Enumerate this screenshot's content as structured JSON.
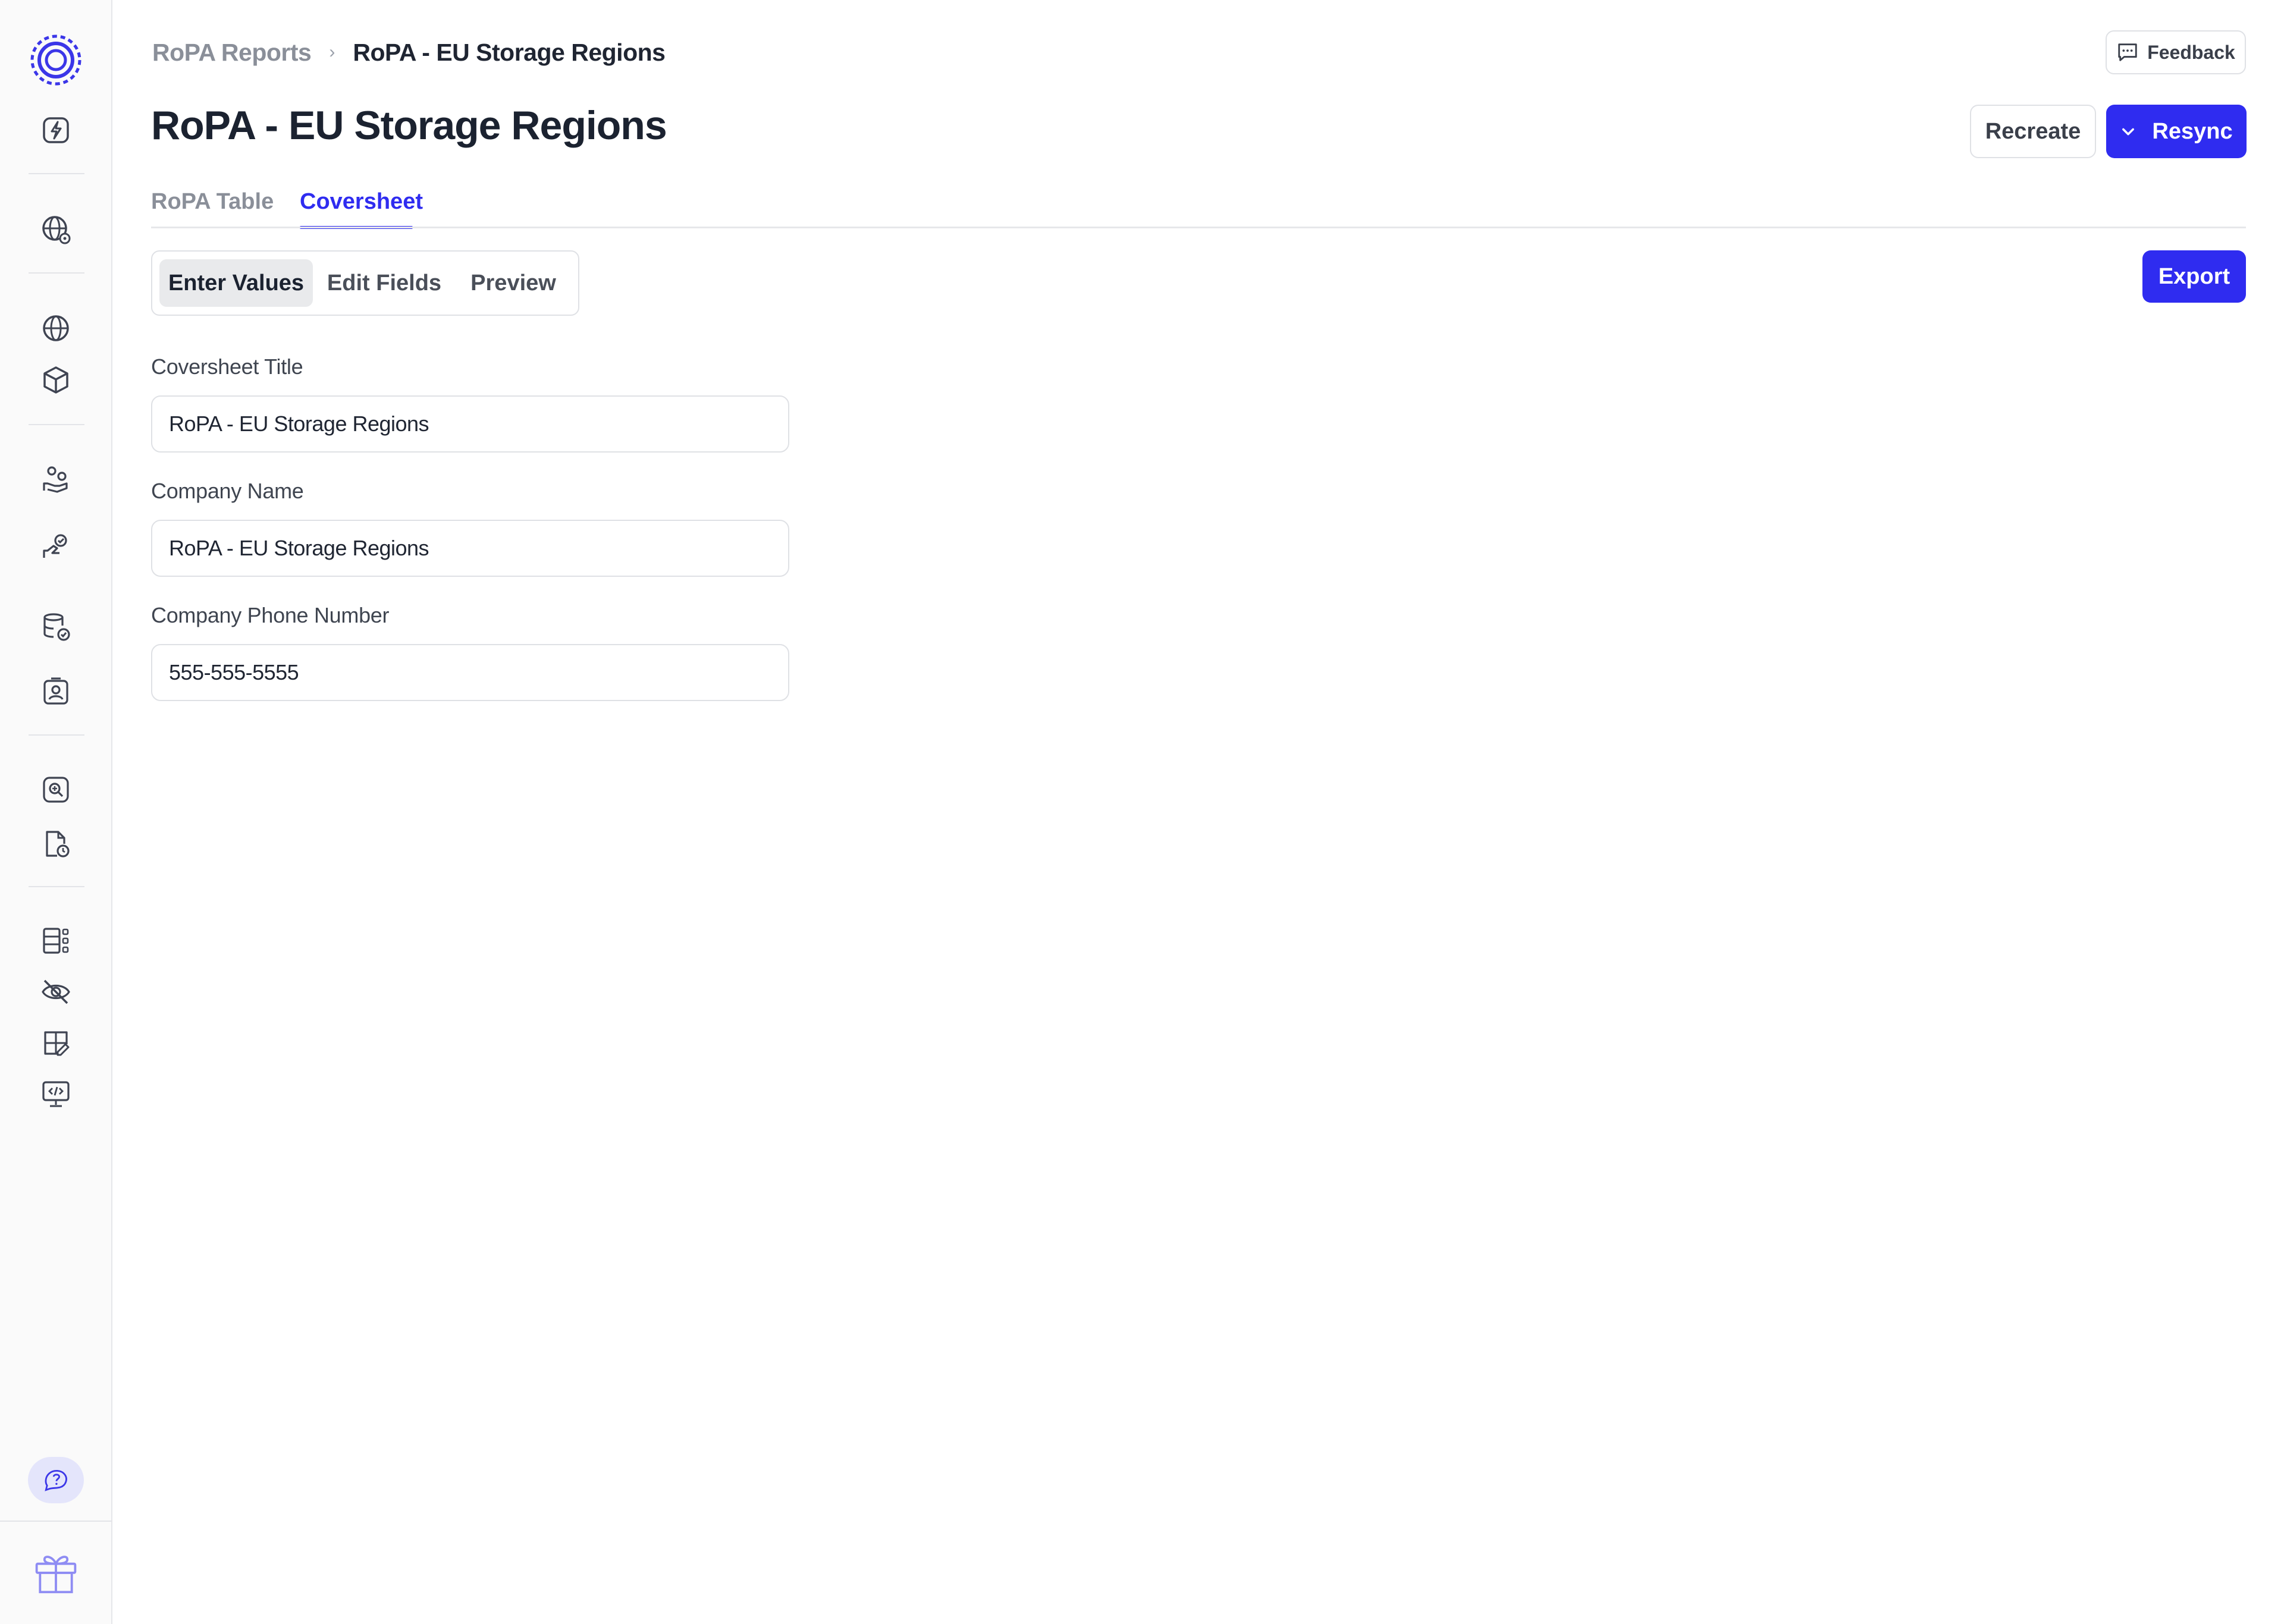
{
  "breadcrumb": {
    "parent": "RoPA Reports",
    "separator": "›",
    "current": "RoPA - EU Storage Regions"
  },
  "header": {
    "title": "RoPA - EU Storage Regions",
    "feedback_label": "Feedback",
    "recreate_label": "Recreate",
    "resync_label": "Resync"
  },
  "tabs": [
    {
      "label": "RoPA Table",
      "active": false
    },
    {
      "label": "Coversheet",
      "active": true
    }
  ],
  "segmented": {
    "options": [
      "Enter Values",
      "Edit Fields",
      "Preview"
    ],
    "selected": "Enter Values"
  },
  "export_label": "Export",
  "form": {
    "fields": [
      {
        "label": "Coversheet Title",
        "value": "RoPA - EU Storage Regions"
      },
      {
        "label": "Company Name",
        "value": "RoPA - EU Storage Regions"
      },
      {
        "label": "Company Phone Number",
        "value": "555-555-5555"
      }
    ]
  },
  "sidebar": {
    "icons": [
      "logo-icon",
      "lightning-icon",
      "globe-network-icon",
      "globe-icon",
      "cube-icon",
      "users-hand-icon",
      "hand-key-icon",
      "database-check-icon",
      "contact-card-icon",
      "search-scan-icon",
      "document-clock-icon",
      "grid-list-icon",
      "eye-off-icon",
      "layout-edit-icon",
      "code-monitor-icon",
      "help-chat-icon",
      "gift-icon"
    ]
  },
  "colors": {
    "accent": "#2f2cf0",
    "sidebar_bg": "#fafafa",
    "text": "#1f2532",
    "muted": "#8a8f99"
  }
}
